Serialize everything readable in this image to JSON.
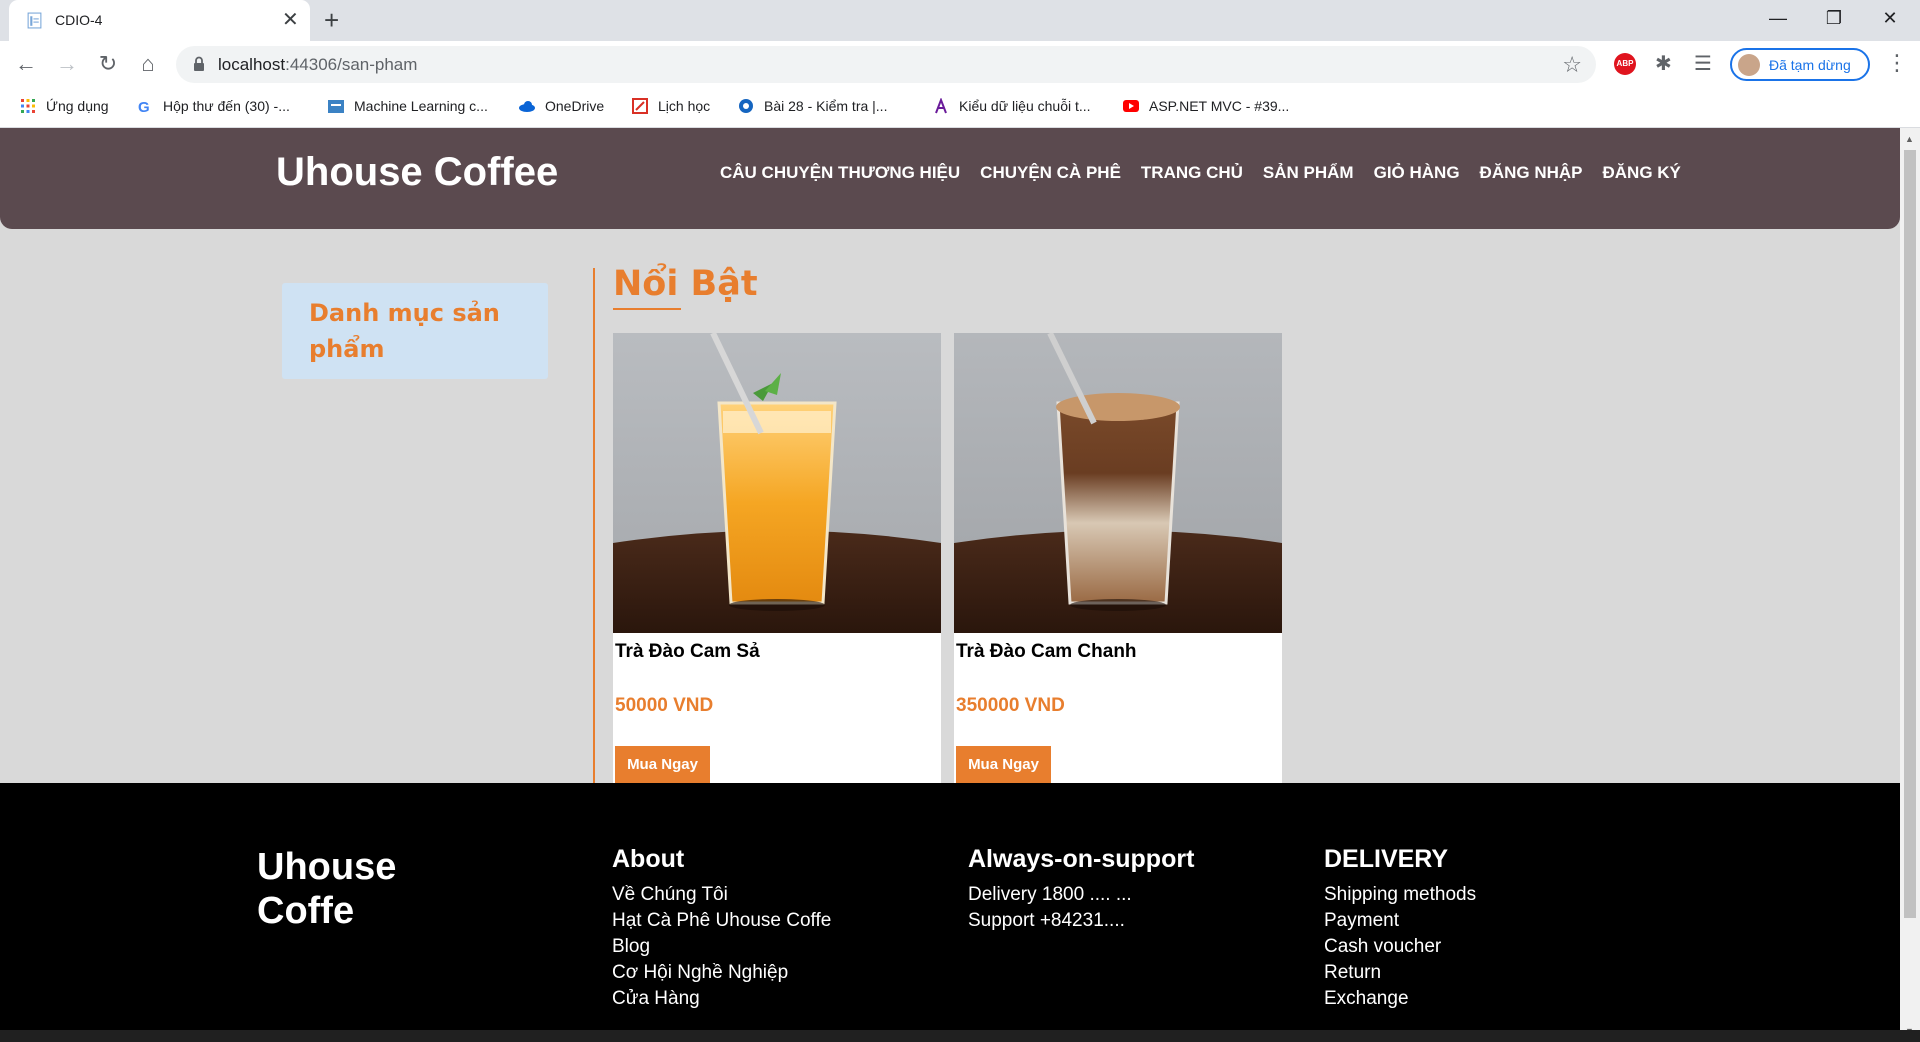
{
  "browser": {
    "tab_title": "CDIO-4",
    "url_host": "localhost",
    "url_path": ":44306/san-pham",
    "profile_label": "Đã tạm dừng",
    "bookmarks": [
      {
        "label": "Ứng dụng",
        "icon": "apps-grid-icon",
        "color": "#ea4335"
      },
      {
        "label": "Hộp thư đến (30) -...",
        "icon": "google-icon",
        "color": "#4285f4"
      },
      {
        "label": "Machine Learning c...",
        "icon": "ml-site-icon",
        "color": "#3b82c4"
      },
      {
        "label": "OneDrive",
        "icon": "onedrive-icon",
        "color": "#0a64d6"
      },
      {
        "label": "Lịch học",
        "icon": "calendar-icon",
        "color": "#d93025"
      },
      {
        "label": "Bài 28 - Kiểm tra |...",
        "icon": "blog-icon",
        "color": "#1565c0"
      },
      {
        "label": "Kiểu dữ liệu chuỗi t...",
        "icon": "k-icon",
        "color": "#6a1b9a"
      },
      {
        "label": "ASP.NET MVC - #39...",
        "icon": "youtube-icon",
        "color": "#ff0000"
      }
    ]
  },
  "site": {
    "brand": "Uhouse Coffee",
    "nav": [
      "CÂU CHUYỆN THƯƠNG HIỆU",
      "CHUYỆN CÀ PHÊ",
      "TRANG CHỦ",
      "SẢN PHẨM",
      "GIỎ HÀNG",
      "ĐĂNG NHẬP",
      "ĐĂNG KÝ"
    ],
    "sidebar_title": "Danh mục sản phẩm",
    "section_title": "Nổi Bật",
    "products": [
      {
        "name": "Trà Đào Cam Sả",
        "price": "50000 VND",
        "button": "Mua Ngay",
        "drink_color": "#f5a623"
      },
      {
        "name": "Trà Đào Cam Chanh",
        "price": "350000 VND",
        "button": "Mua Ngay",
        "drink_color": "#8a5a3a"
      }
    ],
    "accent_color": "#e87e2e",
    "header_color": "#5b4a4f"
  },
  "footer": {
    "brand": "Uhouse Coffe",
    "columns": [
      {
        "title": "About",
        "items": [
          "Về Chúng Tôi",
          "Hạt Cà Phê Uhouse Coffe",
          "Blog",
          "Cơ Hội Nghề Nghiệp",
          "Cửa Hàng"
        ]
      },
      {
        "title": "Always-on-support",
        "items": [
          "Delivery 1800 .... ...",
          "Support +84231...."
        ]
      },
      {
        "title": "DELIVERY",
        "items": [
          "Shipping methods",
          "Payment",
          "Cash voucher",
          "Return",
          "Exchange"
        ]
      }
    ]
  }
}
